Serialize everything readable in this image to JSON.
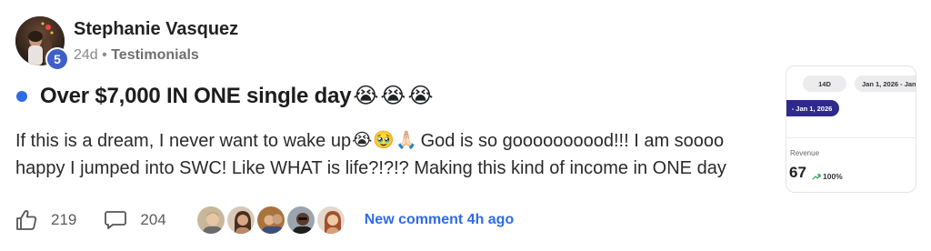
{
  "post": {
    "author": {
      "name": "Stephanie Vasquez",
      "level": "5"
    },
    "meta": {
      "age": "24d",
      "separator": " • ",
      "category": "Testimonials"
    },
    "title": {
      "text": "Over $7,000 IN ONE single day",
      "emojis": [
        "😭",
        "😭",
        "😭"
      ]
    },
    "body": {
      "line1_before": "If this is a dream, I never want to wake up",
      "line1_emojis": [
        "😭",
        "🥹",
        "🙏🏻"
      ],
      "line1_after": "God is so goooooooood!!! I am soooo",
      "line2": "happy I jumped into SWC! Like WHAT is life?!?!? Making this kind of income in ONE day"
    },
    "thumbnail": {
      "chip_14d": "14D",
      "chip_range": "Jan 1, 2026 - Jan",
      "chip_active": "- Jan 1, 2026",
      "revenue_label": "Revenue",
      "revenue_value": "67",
      "revenue_change": "100%"
    },
    "actions": {
      "likes": "219",
      "comments": "204",
      "new_comment": "New comment 4h ago"
    }
  },
  "colors": {
    "accent": "#2f6be8",
    "badge": "#3f5fc8",
    "chip_active": "#2f2a8a"
  },
  "icons": {
    "like": "thumbs-up-icon",
    "comment": "speech-bubble-icon",
    "trend": "trend-up-arrow-icon"
  }
}
